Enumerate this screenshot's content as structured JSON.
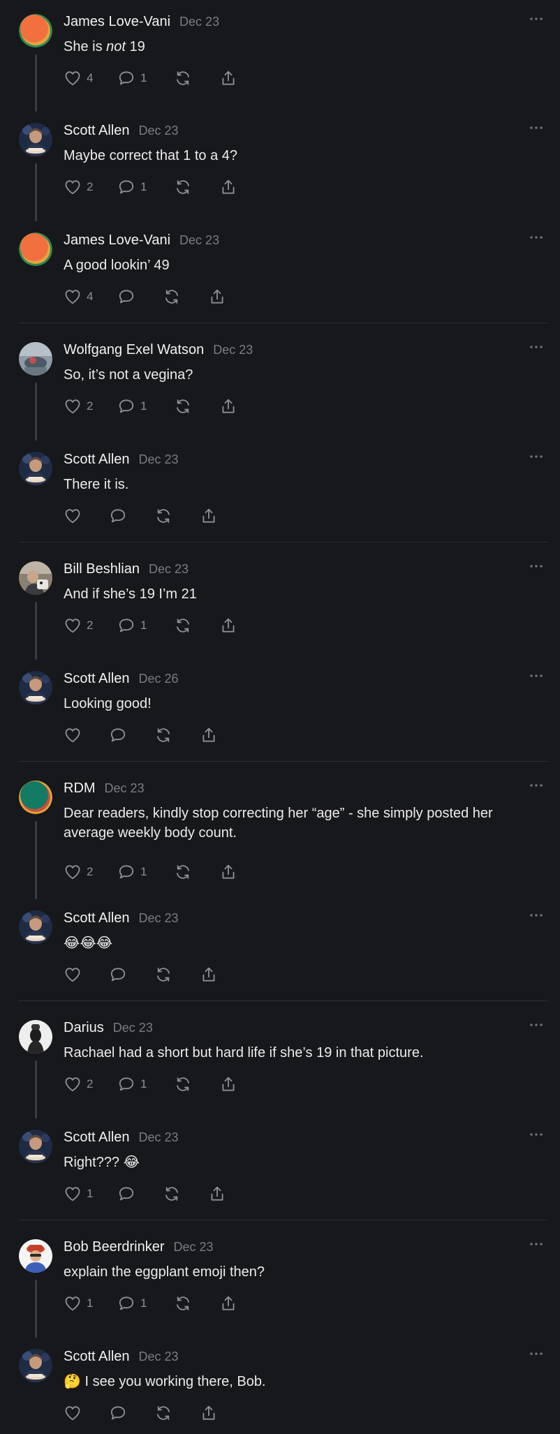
{
  "colors": {
    "background": "#17181b",
    "text_primary": "#f3f3f3",
    "text_secondary": "#7b7c80",
    "icon": "#8e8f93",
    "divider": "#2e2f33",
    "thread_line": "#3a3b3f"
  },
  "actions_icons": [
    "heart-icon",
    "comment-icon",
    "repost-icon",
    "share-icon"
  ],
  "more_icon": "ellipsis-icon",
  "comments": [
    {
      "author": "James Love-Vani",
      "date": "Dec 23",
      "text_html": "She is <em>not</em> 19",
      "likes": "4",
      "replies": "1",
      "avatar": "orange"
    },
    {
      "author": "Scott Allen",
      "date": "Dec 23",
      "text": "Maybe correct that 1 to a 4?",
      "likes": "2",
      "replies": "1",
      "avatar": "scott"
    },
    {
      "author": "James Love-Vani",
      "date": "Dec 23",
      "text": "A good lookin’ 49",
      "likes": "4",
      "replies": "",
      "avatar": "orange"
    },
    {
      "author": "Wolfgang Exel Watson",
      "date": "Dec 23",
      "text": "So, it’s not a vegina?",
      "likes": "2",
      "replies": "1",
      "avatar": "wolfgang"
    },
    {
      "author": "Scott Allen",
      "date": "Dec 23",
      "text": "There it is.",
      "likes": "",
      "replies": "",
      "avatar": "scott"
    },
    {
      "author": "Bill Beshlian",
      "date": "Dec 23",
      "text": "And if she’s 19 I’m 21",
      "likes": "2",
      "replies": "1",
      "avatar": "bill"
    },
    {
      "author": "Scott Allen",
      "date": "Dec 26",
      "text": "Looking good!",
      "likes": "",
      "replies": "",
      "avatar": "scott"
    },
    {
      "author": "RDM",
      "date": "Dec 23",
      "text": "Dear readers, kindly stop correcting her “age” - she simply posted her average weekly body count.",
      "likes": "2",
      "replies": "1",
      "avatar": "teal"
    },
    {
      "author": "Scott Allen",
      "date": "Dec 23",
      "text": "😂😂😂",
      "likes": "",
      "replies": "",
      "avatar": "scott"
    },
    {
      "author": "Darius",
      "date": "Dec 23",
      "text": "Rachael had a short but hard life if she’s 19 in that picture.",
      "likes": "2",
      "replies": "1",
      "avatar": "darius"
    },
    {
      "author": "Scott Allen",
      "date": "Dec 23",
      "text": "Right??? 😂",
      "likes": "1",
      "replies": "",
      "avatar": "scott"
    },
    {
      "author": "Bob Beerdrinker",
      "date": "Dec 23",
      "text": "explain the eggplant emoji then?",
      "likes": "1",
      "replies": "1",
      "avatar": "bob"
    },
    {
      "author": "Scott Allen",
      "date": "Dec 23",
      "text": "🤔 I see you working there, Bob.",
      "likes": "",
      "replies": "",
      "avatar": "scott"
    }
  ]
}
